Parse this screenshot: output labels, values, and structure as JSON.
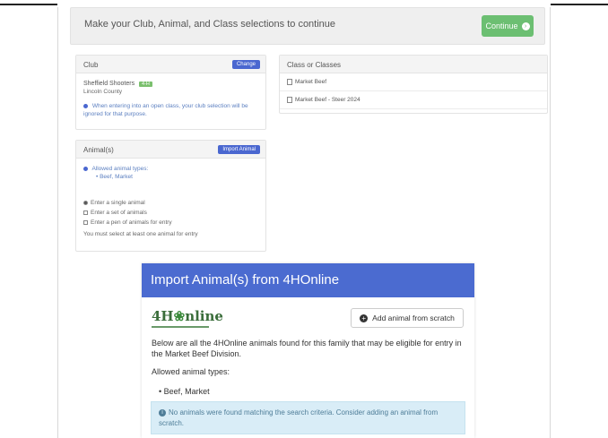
{
  "selection_bar": {
    "message": "Make your Club, Animal, and Class selections to continue",
    "continue_label": "Continue"
  },
  "club_panel": {
    "title": "Club",
    "change_label": "Change",
    "club_name": "Sheffield Shooters",
    "club_tag": "4-H",
    "club_sub": "Lincoln County",
    "note": "When entering into an open class, your club selection will be ignored for that purpose."
  },
  "animals_panel": {
    "title": "Animal(s)",
    "import_label": "Import Animal",
    "allowed_heading": "Allowed animal types:",
    "allowed_types": [
      "Beef, Market"
    ],
    "options": [
      "Enter a single animal",
      "Enter a set of animals",
      "Enter a pen of animals for entry"
    ],
    "hint": "You must select at least one animal for entry"
  },
  "classes_panel": {
    "title": "Class or Classes",
    "items": [
      "Market Beef",
      "Market Beef - Steer 2024"
    ]
  },
  "modal": {
    "title": "Import Animal(s) from 4HOnline",
    "logo_text": "4H",
    "logo_clover": "❀",
    "logo_text2": "nline",
    "add_button": "Add animal from scratch",
    "description": "Below are all the 4HOnline animals found for this family that may be eligible for entry in the Market Beef Division.",
    "allowed_heading": "Allowed animal types:",
    "allowed_types": [
      "Beef, Market"
    ],
    "alert": "No animals were found matching the search criteria. Consider adding an animal from scratch."
  }
}
